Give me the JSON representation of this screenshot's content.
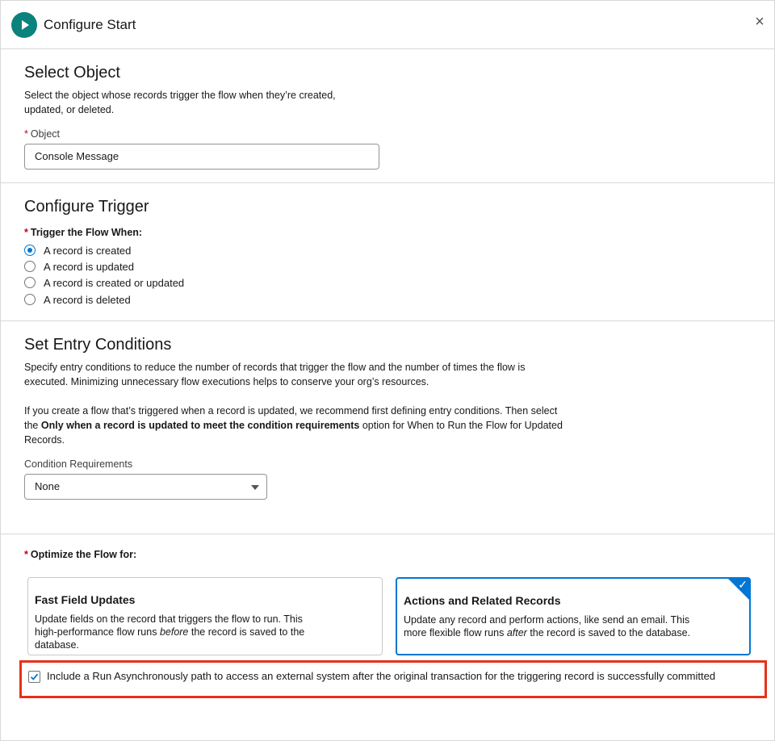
{
  "header": {
    "title": "Configure Start",
    "start_icon": "play-icon",
    "close_icon": "close-icon",
    "close_glyph": "×"
  },
  "select_object": {
    "heading": "Select Object",
    "description_line1": "Select the object whose records trigger the flow when they’re created,",
    "description_line2": "updated, or deleted.",
    "required_marker": "*",
    "field_label": "Object",
    "field_value": "Console Message"
  },
  "configure_trigger": {
    "heading": "Configure Trigger",
    "required_marker": "*",
    "field_label": "Trigger the Flow When:",
    "options": [
      {
        "label": "A record is created",
        "checked": true
      },
      {
        "label": "A record is updated",
        "checked": false
      },
      {
        "label": "A record is created or updated",
        "checked": false
      },
      {
        "label": "A record is deleted",
        "checked": false
      }
    ]
  },
  "entry_conditions": {
    "heading": "Set Entry Conditions",
    "para1_line1": "Specify entry conditions to reduce the number of records that trigger the flow and the number of times the flow is",
    "para1_line2": "executed. Minimizing unnecessary flow executions helps to conserve your org’s resources.",
    "para2_line1": "If you create a flow that’s triggered when a record is updated, we recommend first defining entry conditions. Then select",
    "para2_line2_pre": "the ",
    "para2_line2_bold": "Only when a record is updated to meet the condition requirements",
    "para2_line2_post": " option for When to Run the Flow for Updated",
    "para2_line3": "Records.",
    "condition_label": "Condition Requirements",
    "condition_value": "None"
  },
  "optimize": {
    "required_marker": "*",
    "label": "Optimize the Flow for:",
    "cards": [
      {
        "title": "Fast Field Updates",
        "line1": "Update fields on the record that triggers the flow to run. This",
        "line2_pre": "high-performance flow runs ",
        "line2_em": "before",
        "line2_post": " the record is saved to the",
        "line3": "database.",
        "selected": false
      },
      {
        "title": "Actions and Related Records",
        "line1": "Update any record and perform actions, like send an email. This",
        "line2_pre": "more flexible flow runs ",
        "line2_em": "after",
        "line2_post": " the record is saved to the database.",
        "selected": true
      }
    ],
    "selected_check_glyph": "✓",
    "async_checked": true,
    "async_label": "Include a Run Asynchronously path to access an external system after the original transaction for the triggering record is successfully committed"
  },
  "colors": {
    "accent": "#0176d3",
    "start_icon_bg": "#0b827c",
    "required": "#ba0517",
    "highlight": "#e8311a"
  }
}
